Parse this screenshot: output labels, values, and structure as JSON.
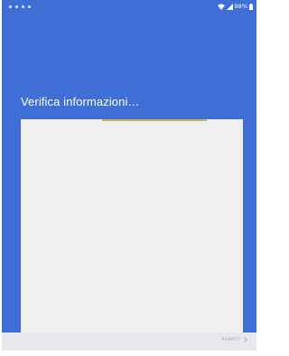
{
  "status_bar": {
    "battery_text": "98%",
    "icons": [
      "wifi-icon",
      "signal-icon",
      "battery-icon"
    ],
    "notification_dots": 4
  },
  "screen": {
    "title": "Verifica informazioni…"
  },
  "progress": {
    "indeterminate": true
  },
  "footer": {
    "next_label": "AVANTI"
  },
  "colors": {
    "background": "#3f6fd6",
    "card": "#efefef",
    "progress": "#c9b54a",
    "footer": "#e6e8ec",
    "disabled_text": "#a8adb5"
  }
}
